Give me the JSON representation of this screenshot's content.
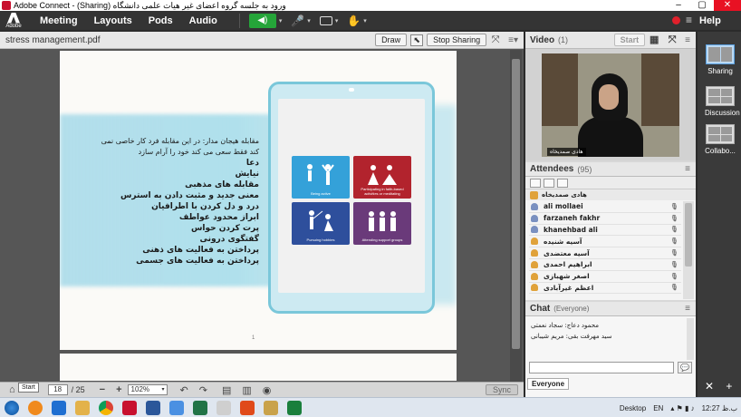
{
  "window": {
    "title": "Adobe Connect - (Sharing) ورود به جلسه گروه اعضای غیر هیات علمی دانشگاه",
    "min": "–",
    "max": "▢",
    "close": "✕"
  },
  "menubar": {
    "logo_text": "Adobe",
    "items": [
      "Meeting",
      "Layouts",
      "Pods",
      "Audio"
    ],
    "help": "Help",
    "speaker_icon": "◀)",
    "mic_icon": "🎤",
    "hamburger": "≡"
  },
  "share_pod": {
    "title": "stress management.pdf",
    "draw_label": "Draw",
    "stop_label": "Stop Sharing",
    "page_current": "18",
    "page_total": "/ 25",
    "zoom": "102%",
    "sync_label": "Sync",
    "minus": "−",
    "plus": "+",
    "zoom_caret": "▾",
    "rotate_left": "↶",
    "rotate_right": "↷",
    "page_number": "1"
  },
  "slide": {
    "persian_lines": [
      "مقابله هیجان مدار: در این مقابله فرد کار خاصی نمی",
      "کند فقط سعی می کند خود را آرام سازد",
      "دعا",
      "نیایش",
      "مقابله های مذهبی",
      "معنی جدید و مثبت دادن به استرس",
      "درد و دل کردن با اطرافیان",
      "ابراز محدود عواطف",
      "پرت کردن حواس",
      "گفتگوی درونی",
      "پرداختن به فعالیت های ذهنی",
      "پرداختن به فعالیت های جسمی"
    ],
    "tiles": [
      {
        "caption": "Being active",
        "color": "#34a1d9"
      },
      {
        "caption": "Participating in faith-based activities or meditating",
        "color": "#b2232d"
      },
      {
        "caption": "Pursuing hobbies",
        "color": "#2e4f9c"
      },
      {
        "caption": "Attending support groups",
        "color": "#6a3a7a"
      }
    ]
  },
  "video_pod": {
    "title": "Video",
    "count": "(1)",
    "start_label": "Start",
    "presenter_name": "هادی صمدیخاه"
  },
  "attendees_pod": {
    "title": "Attendees",
    "count": "(95)",
    "host": "هادی صمدیخاه",
    "rows": [
      "ali mollaei",
      "farzaneh fakhr",
      "khanehbad ali",
      "آسیه شنیده",
      "آسیه معتضدی",
      "ابراهیم احمدی",
      "اصغر شهبازی",
      "اعظم غیرآبادی"
    ]
  },
  "chat_pod": {
    "title": "Chat",
    "scope": "(Everyone)",
    "messages": [
      "محمود دعاج: سجاد نعمتی",
      "سید مهرفت بقی: مریم شیبانی"
    ],
    "tab": "Everyone",
    "send_icon": "💬"
  },
  "layouts": {
    "items": [
      "Sharing",
      "Discussion",
      "Collabo..."
    ],
    "close_icon": "✕",
    "add_icon": "+"
  },
  "taskbar": {
    "start_tooltip": "Start",
    "desktop": "Desktop",
    "lang": "EN",
    "time": "12:27 ب.ظ"
  },
  "colors": {
    "speaker_green": "#25a539",
    "record_red": "#e0202b",
    "slide_blue": "#7ac7da"
  }
}
